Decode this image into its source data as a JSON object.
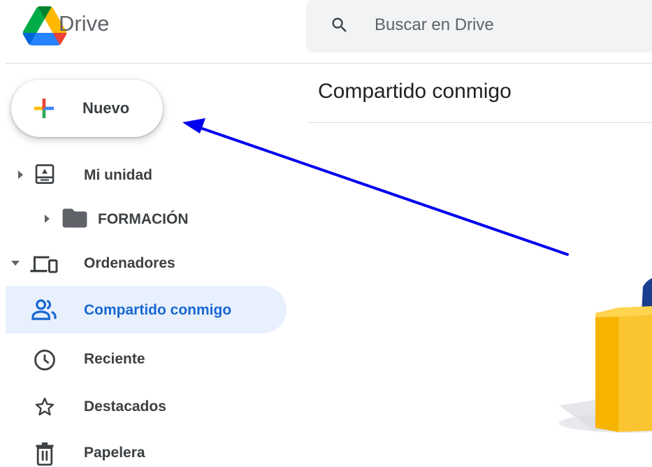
{
  "header": {
    "app_title": "Drive",
    "search": {
      "placeholder": "Buscar en Drive"
    }
  },
  "new_button": {
    "label": "Nuevo"
  },
  "sidebar": {
    "items": [
      {
        "label": "Mi unidad",
        "icon": "my-drive-icon",
        "expandable": true,
        "expanded": false
      },
      {
        "label": "FORMACIÓN",
        "icon": "folder-icon",
        "expandable": true,
        "expanded": false
      },
      {
        "label": "Ordenadores",
        "icon": "computers-icon",
        "expandable": true,
        "expanded": true
      },
      {
        "label": "Compartido conmigo",
        "icon": "shared-people-icon",
        "active": true
      },
      {
        "label": "Reciente",
        "icon": "clock-icon"
      },
      {
        "label": "Destacados",
        "icon": "star-icon"
      },
      {
        "label": "Papelera",
        "icon": "trash-icon"
      }
    ]
  },
  "main": {
    "title": "Compartido conmigo"
  },
  "colors": {
    "active_bg": "#e8f0fe",
    "active_text": "#1967d2",
    "annotation_arrow": "#0000ee",
    "drive_green": "#0f9d58",
    "drive_yellow": "#f4b400",
    "drive_blue": "#4285f4"
  }
}
